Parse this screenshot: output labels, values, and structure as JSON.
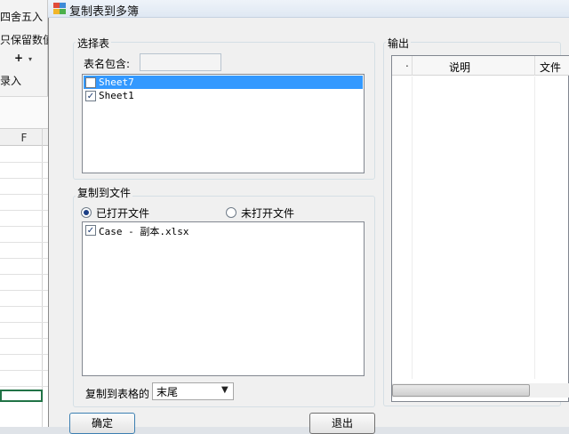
{
  "excel": {
    "ribbon_items": [
      "四舍五入",
      "只保留数值",
      "+",
      "录入"
    ],
    "column_header": "F"
  },
  "dialog": {
    "title": "复制表到多簿",
    "select_group": {
      "label": "选择表",
      "filter_label": "表名包含:",
      "filter_value": "",
      "sheets": [
        {
          "name": "Sheet7",
          "checked": false,
          "selected": true
        },
        {
          "name": "Sheet1",
          "checked": true,
          "selected": false
        }
      ]
    },
    "copy_group": {
      "label": "复制到文件",
      "radio_open": "已打开文件",
      "radio_unopen": "未打开文件",
      "files": [
        {
          "name": "Case - 副本.xlsx",
          "checked": true
        }
      ]
    },
    "position": {
      "label": "复制到表格的",
      "value": "末尾"
    },
    "output": {
      "label": "输出",
      "columns": [
        ".",
        "说明",
        "文件"
      ]
    },
    "buttons": {
      "ok": "确定",
      "exit": "退出"
    }
  },
  "colors": {
    "selection": "#3399ff",
    "check": "#1b3a72",
    "excel_green": "#217346"
  }
}
